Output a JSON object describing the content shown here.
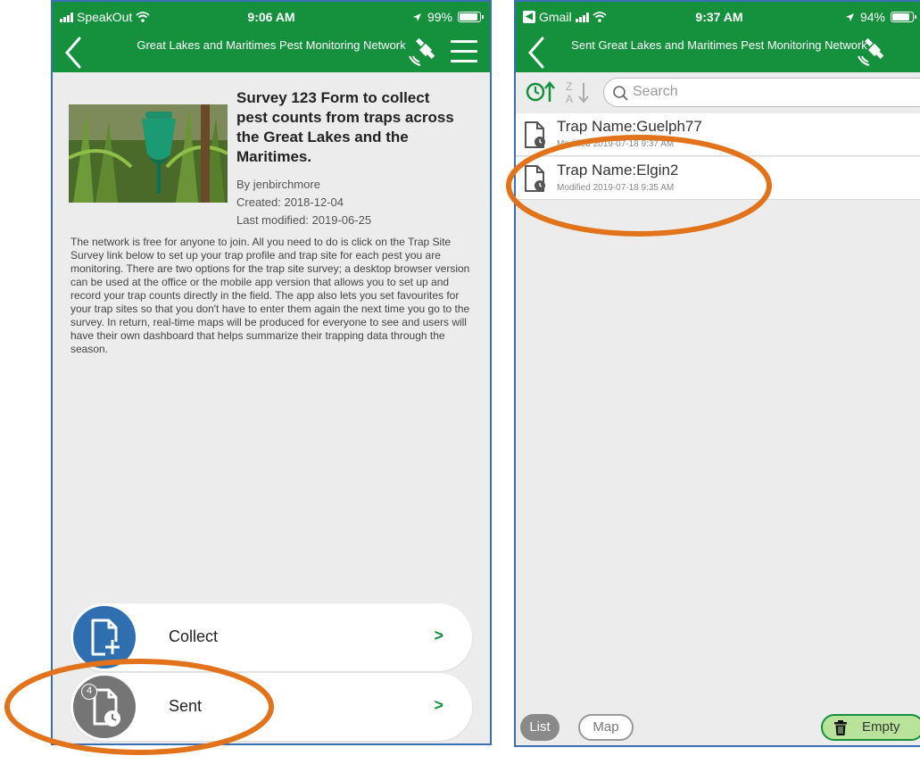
{
  "left": {
    "status": {
      "carrier": "SpeakOut",
      "time": "9:06 AM",
      "battery": "99%"
    },
    "header": {
      "title": "Great Lakes and Maritimes Pest Monitoring Network"
    },
    "survey": {
      "title": "Survey 123 Form to collect pest counts from traps across the Great Lakes and the Maritimes.",
      "author": "By jenbirchmore",
      "created": "Created: 2018-12-04",
      "modified": "Last modified: 2019-06-25",
      "description": "The network is free for anyone to join.  All you need to do is click on the Trap Site Survey link below to set up your trap profile and trap site for each pest you are monitoring.  There are two options for the trap site survey; a desktop browser version can be used at the office or the mobile app version that allows you to set up and record your trap counts directly in the field.  The app also lets you set favourites for your trap sites so that you don't have to enter them again the next time you go to the survey.  In return, real-time maps will be produced for everyone to see and users will have their own dashboard that helps summarize their trapping data through the season."
    },
    "buttons": {
      "collect": "Collect",
      "sent": "Sent",
      "sent_badge": "4",
      "chevron": ">"
    }
  },
  "right": {
    "status": {
      "app": "Gmail",
      "time": "9:37 AM",
      "battery": "94%"
    },
    "header": {
      "title": "Sent Great Lakes and Maritimes Pest Monitoring Network"
    },
    "search": {
      "placeholder": "Search"
    },
    "items": [
      {
        "name": "Trap Name:Guelph77",
        "modified": "Modified 2019-07-18 9:37 AM"
      },
      {
        "name": "Trap Name:Elgin2",
        "modified": "Modified 2019-07-18 9:35 AM"
      }
    ],
    "footer": {
      "list": "List",
      "map": "Map",
      "empty": "Empty"
    }
  },
  "colors": {
    "brand_green": "#15903c",
    "collect_blue": "#2f6fb0",
    "sent_gray": "#757575",
    "highlight_orange": "#e2731a"
  }
}
